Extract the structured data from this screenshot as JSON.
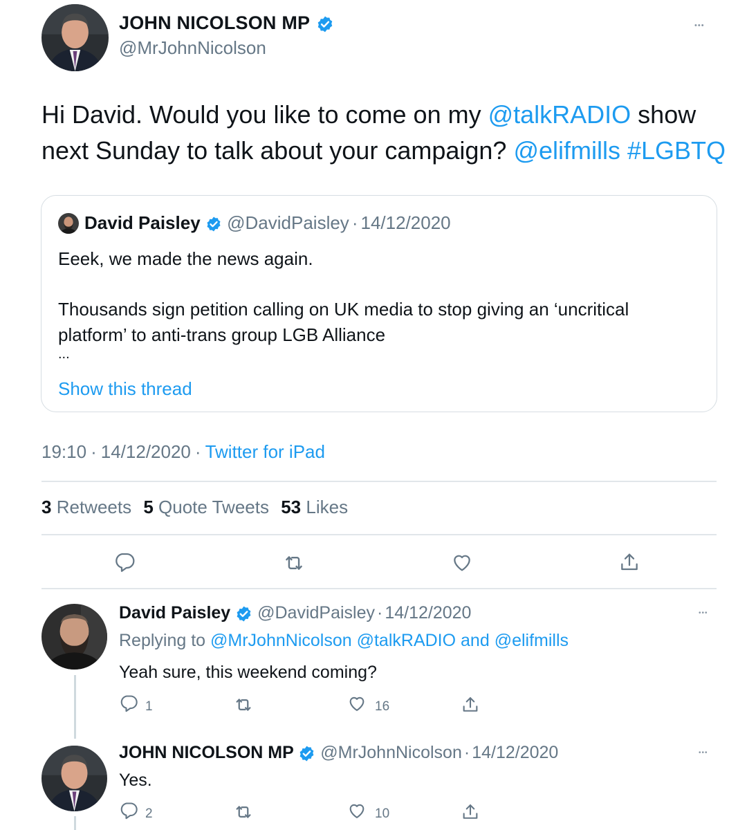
{
  "main_tweet": {
    "author_name": "JOHN NICOLSON MP",
    "author_handle": "@MrJohnNicolson",
    "text_parts": {
      "p1": "Hi David. Would you like to come on my ",
      "mention1": "@talkRADIO",
      "p2": " show next Sunday to talk about your campaign? ",
      "mention2": "@elifmills",
      "p3": " ",
      "hashtag": "#LGBTQ"
    },
    "time": "19:10",
    "date": "14/12/2020",
    "source": "Twitter for iPad",
    "stats": {
      "retweets_count": "3",
      "retweets_label": "Retweets",
      "quotes_count": "5",
      "quotes_label": "Quote Tweets",
      "likes_count": "53",
      "likes_label": "Likes"
    }
  },
  "quoted_tweet": {
    "author_name": "David Paisley",
    "author_handle": "@DavidPaisley",
    "date": "14/12/2020",
    "line1": "Eeek, we made the news again.",
    "line2": "Thousands sign petition calling on UK media to stop giving an ‘uncritical",
    "line3": "platform’ to anti-trans group LGB Alliance",
    "ellipsis": "...",
    "show_thread": "Show this thread"
  },
  "replies": [
    {
      "author_name": "David Paisley",
      "author_handle": "@DavidPaisley",
      "date": "14/12/2020",
      "replying_prefix": "Replying to ",
      "replying_to_1": "@MrJohnNicolson",
      "replying_to_2": "@talkRADIO",
      "replying_and": "and",
      "replying_to_3": "@elifmills",
      "text": "Yeah sure, this weekend coming?",
      "reply_count": "1",
      "like_count": "16"
    },
    {
      "author_name": "JOHN NICOLSON MP",
      "author_handle": "@MrJohnNicolson",
      "date": "14/12/2020",
      "text": "Yes.",
      "reply_count": "2",
      "like_count": "10"
    }
  ],
  "separator": "·",
  "more_glyph": "•••",
  "colors": {
    "link": "#1d9bf0",
    "verified": "#1d9bf0",
    "secondary_text": "#657786",
    "divider": "#e1e6ea"
  }
}
